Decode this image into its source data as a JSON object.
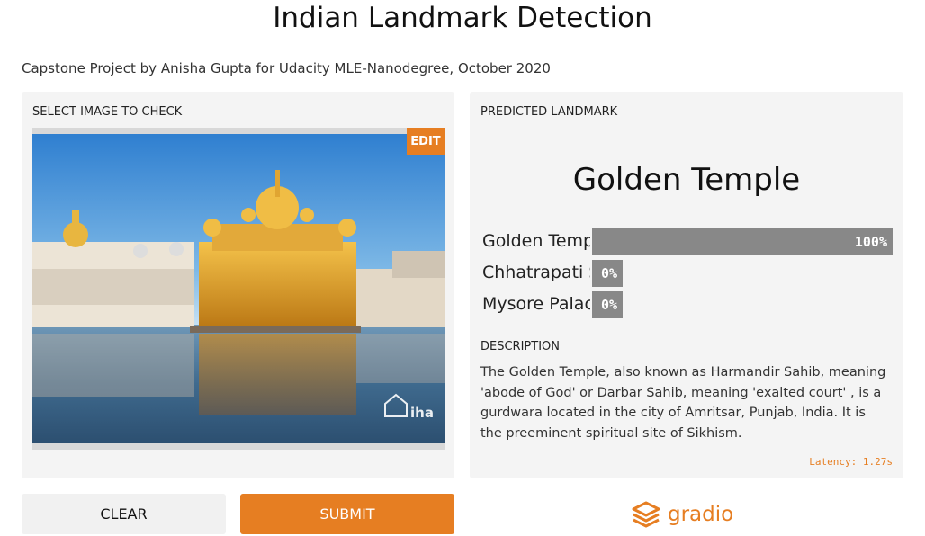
{
  "app": {
    "title": "Indian Landmark Detection",
    "subtitle": "Capstone Project by Anisha Gupta for Udacity MLE-Nanodegree, October 2020"
  },
  "input_panel": {
    "label": "SELECT IMAGE TO CHECK",
    "edit_label": "EDIT",
    "image_watermark": "iha"
  },
  "output_panel": {
    "label": "PREDICTED LANDMARK",
    "prediction": "Golden Temple",
    "confidences": [
      {
        "label": "Golden Temple",
        "value_text": "100%",
        "value": 1.0
      },
      {
        "label": "Chhatrapati Shivaji",
        "value_text": "0%",
        "value": 0.0
      },
      {
        "label": "Mysore Palace",
        "value_text": "0%",
        "value": 0.0
      }
    ],
    "description_label": "DESCRIPTION",
    "description": "The Golden Temple, also known as Harmandir Sahib, meaning 'abode of God' or Darbar Sahib, meaning 'exalted court' , is a gurdwara located in the city of Amritsar, Punjab, India. It is the preeminent spiritual site of Sikhism.",
    "latency": "Latency: 1.27s"
  },
  "actions": {
    "clear_label": "CLEAR",
    "submit_label": "SUBMIT"
  },
  "brand": {
    "name": "gradio",
    "icon": "gradio-logo-icon"
  },
  "colors": {
    "accent": "#e67e22",
    "panel_bg": "#f4f4f4",
    "bar": "#888888"
  }
}
